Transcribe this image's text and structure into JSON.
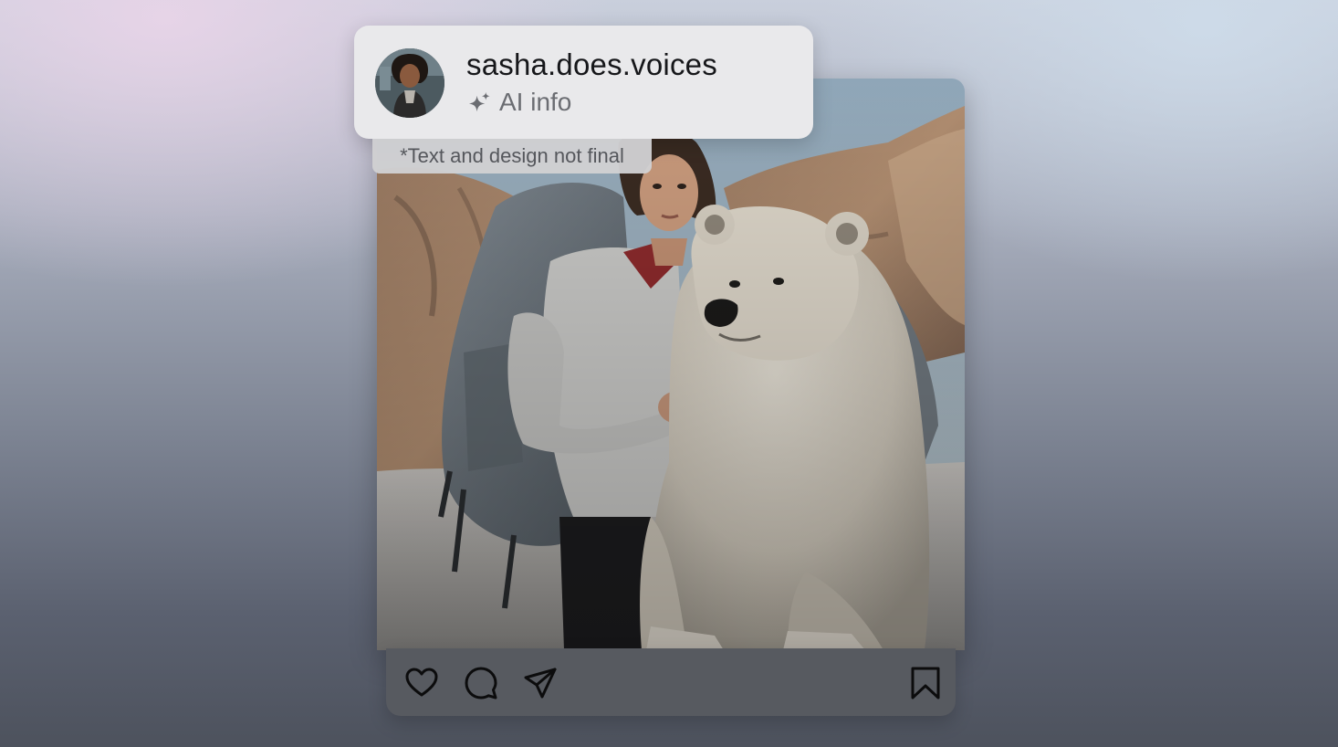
{
  "profile": {
    "username": "sasha.does.voices",
    "ai_info_label": "AI info",
    "avatar_icon": "profile-photo"
  },
  "disclaimer": {
    "text": "*Text and design not final"
  },
  "post": {
    "image_icon": "woman-with-polar-bear-photo"
  },
  "actions": {
    "like_icon": "heart-icon",
    "comment_icon": "comment-bubble-icon",
    "share_icon": "paper-plane-icon",
    "save_icon": "bookmark-icon"
  },
  "colors": {
    "card_background": "#e9e9eb",
    "action_bar": "#575a60",
    "username_text": "#16171a",
    "secondary_text": "#6b6d72"
  }
}
